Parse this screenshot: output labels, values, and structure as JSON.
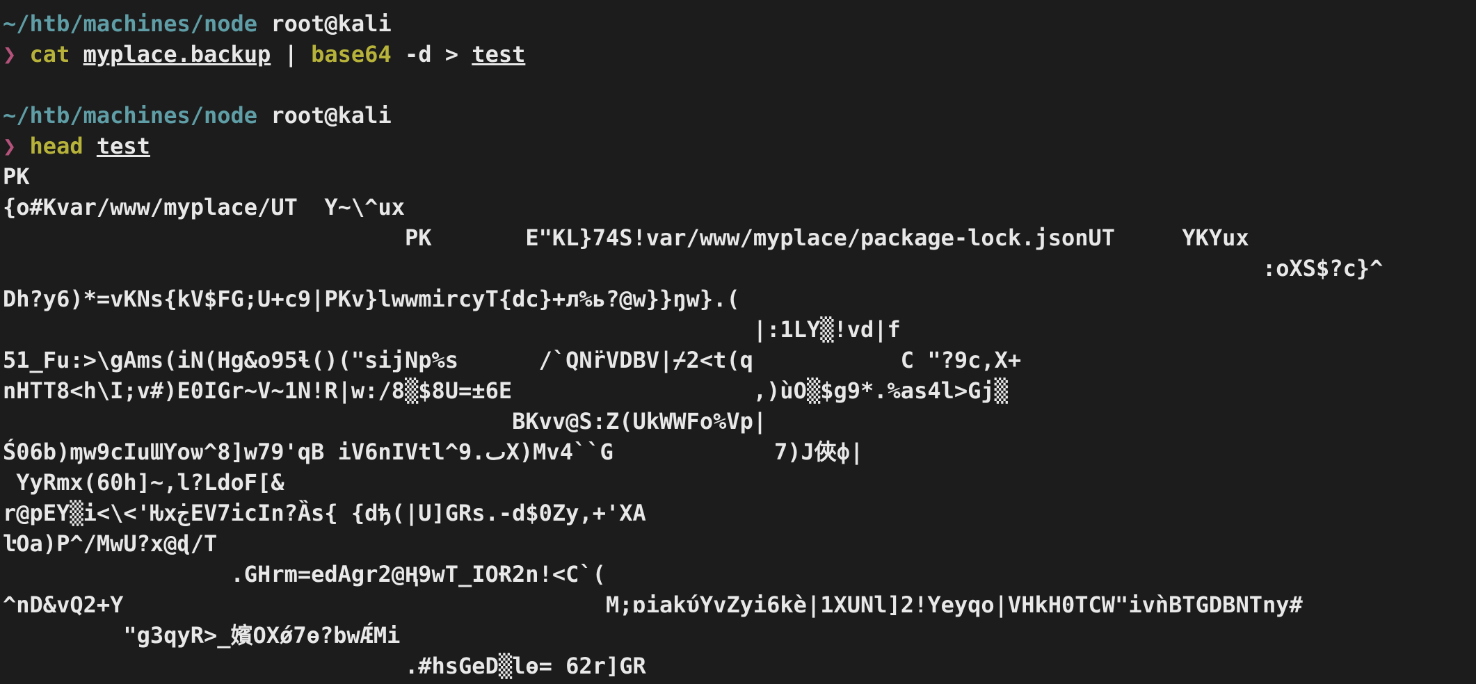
{
  "terminal": {
    "prompt1": {
      "path": "~/htb/machines/node",
      "user": "root@kali",
      "arrow": "❯",
      "cmd": "cat",
      "file": "myplace.backup",
      "pipe": " | ",
      "cmd2": "base64",
      "flags": " -d > ",
      "out": "test"
    },
    "prompt2": {
      "path": "~/htb/machines/node",
      "user": "root@kali",
      "arrow": "❯",
      "cmd": "head",
      "file": "test"
    },
    "output": [
      "PK",
      "{o#Kvar/www/myplace/UT  Y~\\^ux",
      "                              PK       E\"KL}74S!var/www/myplace/package-lock.jsonUT     YKYux",
      "                                                                                              :oXS$?c}^",
      "Dh?y6)*=vKNs{kV$FG;U+c9|PKv}lwwmircyT{dc}+л%ь?@w}}ŋw}.(",
      "                                                        |:1LY▒!vd|f",
      "51_Fu:>\\gAms(iN(Hg&o95ɬ()(\"sijNp%s      /`QNr̈VDBV|⌿2<t(q           C \"?9c,X+",
      "nHTT8<h\\I;v#)E0IGr~V~1N!R|w:/8▒$8U=±6E                  ,)ùO▒$g9*.%as4l>Gj▒",
      "                                      BKvv@S:Z(UkWWFo%Vp|",
      "Ś06b)ɱw9cIuƜƳoѡ^8]w79'qB iV6nIVtl^ٮ.9X)Mv4``G            7)J俠ф|",
      " YyRmx(60h]~,l?LdoF[&",
      "r@pEY▒i<\\<'Ƕxج̇EV7icIn?Ȁs{ {dђ(|U]GRs.-d$0Zy,+'XA",
      "ŀOa)P^/MwU?x@ɖ/T",
      "                 .GHrm=edAgr2@Ⱨ9wT_IOɌ2n!<C`(",
      "^nD&vQ2+Y                                    M;ɒiakύYvZyi6kѐ|1XUNl]2!Yeyqo|VHkH0TCW\"ivǹBTGDBNTny#",
      "         \"g3qyR>_嬪OXǿ7ɵ?bwǼMi",
      "                              .#hsGeD▒lɵ= 62r]GR"
    ]
  }
}
